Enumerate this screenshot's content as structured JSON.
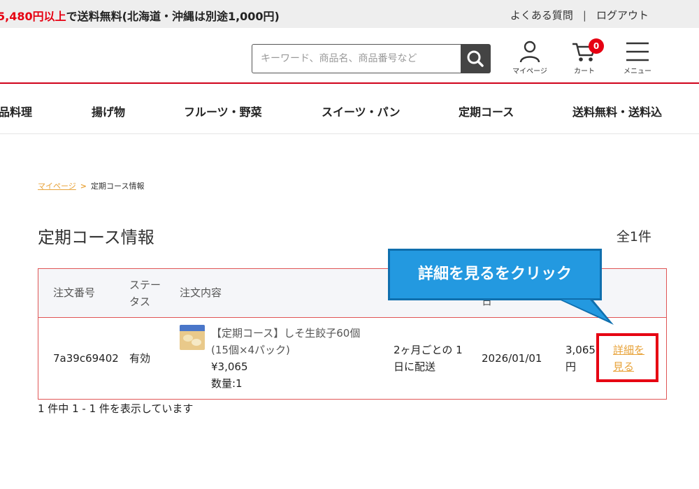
{
  "topbar": {
    "promo_prefix": "5,480円以上",
    "promo_rest": "で送料無料(北海道・沖縄は別途1,000円)",
    "faq": "よくある質問",
    "separator": "|",
    "logout": "ログアウト"
  },
  "header": {
    "search_placeholder": "キーワード、商品名、商品番号など",
    "mypage_label": "マイページ",
    "cart_label": "カート",
    "cart_count": "0",
    "menu_label": "メニュー"
  },
  "nav": {
    "items": [
      "品料理",
      "揚げ物",
      "フルーツ・野菜",
      "スイーツ・パン",
      "定期コース",
      "送料無料・送料込"
    ]
  },
  "breadcrumb": {
    "mypage": "マイページ",
    "chevron": ">",
    "current": "定期コース情報"
  },
  "page": {
    "title": "定期コース情報",
    "count": "全1件"
  },
  "table": {
    "headers": {
      "order_no": "注文番号",
      "status_1": "ステー",
      "status_2": "タス",
      "content": "注文内容",
      "date_fragment": "日"
    },
    "row": {
      "order_no": "7a39c69402",
      "status": "有効",
      "product_name_1": "【定期コース】しそ生餃子60個",
      "product_name_2": "(15個×4パック)",
      "price": "¥3,065",
      "quantity": "数量:1",
      "cycle_1": "2ヶ月ごとの 1",
      "cycle_2": "日に配送",
      "next_date": "2026/01/01",
      "amount_1": "3,065",
      "amount_2": "円",
      "detail_1": "詳細を",
      "detail_2": "見る"
    }
  },
  "callout": {
    "text": "詳細を見るをクリック"
  },
  "pager": {
    "text": "1 件中 1 - 1 件を表示しています"
  },
  "colors": {
    "accent_red": "#e60012",
    "link_orange": "#e8a33a",
    "callout_blue": "#2399e0"
  }
}
